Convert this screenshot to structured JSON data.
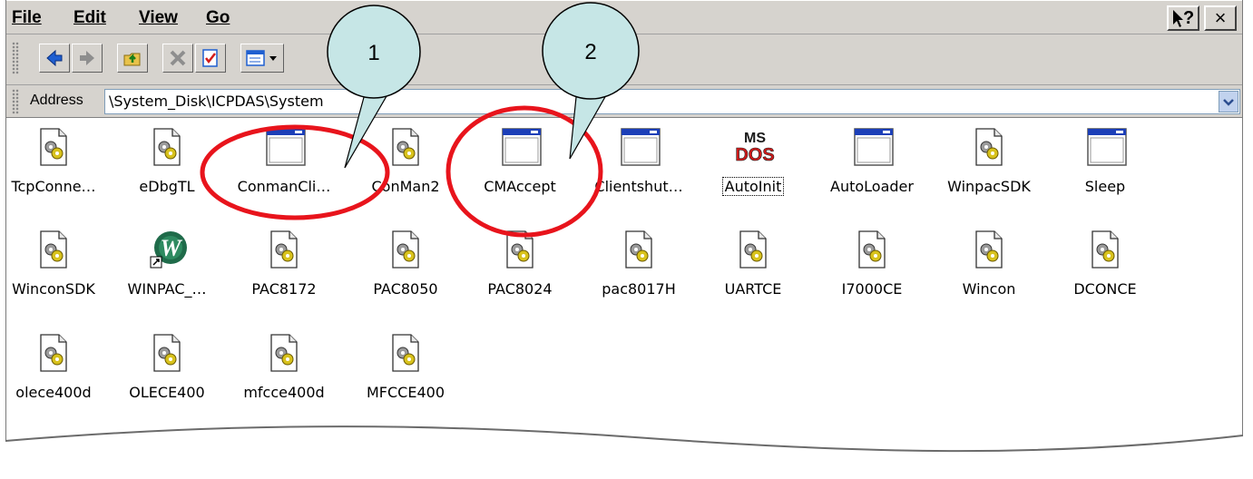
{
  "menu": {
    "file": "File",
    "edit": "Edit",
    "view": "View",
    "go": "Go",
    "help_symbol": "?",
    "close_symbol": "×"
  },
  "address": {
    "label": "Address",
    "value": "\\System_Disk\\ICPDAS\\System"
  },
  "files": [
    {
      "label": "TcpConne…",
      "icon": "system-file-icon"
    },
    {
      "label": "eDbgTL",
      "icon": "system-file-icon"
    },
    {
      "label": "ConmanCli…",
      "icon": "application-window-icon"
    },
    {
      "label": "ConMan2",
      "icon": "system-file-icon"
    },
    {
      "label": "CMAccept",
      "icon": "application-window-icon"
    },
    {
      "label": "Clientshut…",
      "icon": "application-window-icon"
    },
    {
      "label": "AutoInit",
      "icon": "ms-dos-icon"
    },
    {
      "label": "AutoLoader",
      "icon": "application-window-icon"
    },
    {
      "label": "WinpacSDK",
      "icon": "system-file-icon"
    },
    {
      "label": "Sleep",
      "icon": "application-window-icon"
    },
    {
      "label": "WinconSDK",
      "icon": "system-file-icon"
    },
    {
      "label": "WINPAC_…",
      "icon": "winpac-shortcut-icon"
    },
    {
      "label": "PAC8172",
      "icon": "system-file-icon"
    },
    {
      "label": "PAC8050",
      "icon": "system-file-icon"
    },
    {
      "label": "PAC8024",
      "icon": "system-file-icon"
    },
    {
      "label": "pac8017H",
      "icon": "system-file-icon"
    },
    {
      "label": "UARTCE",
      "icon": "system-file-icon"
    },
    {
      "label": "I7000CE",
      "icon": "system-file-icon"
    },
    {
      "label": "Wincon",
      "icon": "system-file-icon"
    },
    {
      "label": "DCONCE",
      "icon": "system-file-icon"
    },
    {
      "label": "olece400d",
      "icon": "system-file-icon"
    },
    {
      "label": "OLECE400",
      "icon": "system-file-icon"
    },
    {
      "label": "mfcce400d",
      "icon": "system-file-icon"
    },
    {
      "label": "MFCCE400",
      "icon": "system-file-icon"
    }
  ],
  "annotations": {
    "callout_1": "1",
    "callout_2": "2",
    "callout_color": "#c6e6e6",
    "highlight_color": "#e8141c"
  },
  "colors": {
    "chrome": "#d6d3ce",
    "dropdown": "#c1d2ee"
  }
}
